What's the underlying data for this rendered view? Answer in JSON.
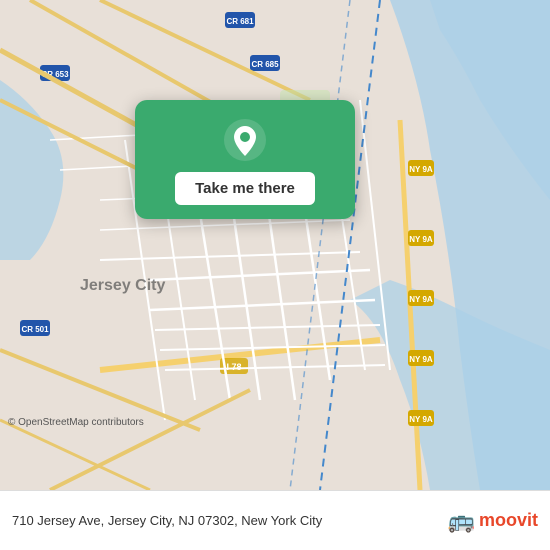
{
  "map": {
    "background_color": "#e8e0d8"
  },
  "popup": {
    "button_label": "Take me there",
    "background_color": "#3aaa6e"
  },
  "bottom_bar": {
    "address": "710 Jersey Ave, Jersey City, NJ 07302, New York City",
    "osm_credit": "© OpenStreetMap contributors",
    "moovit_label": "moovit"
  }
}
